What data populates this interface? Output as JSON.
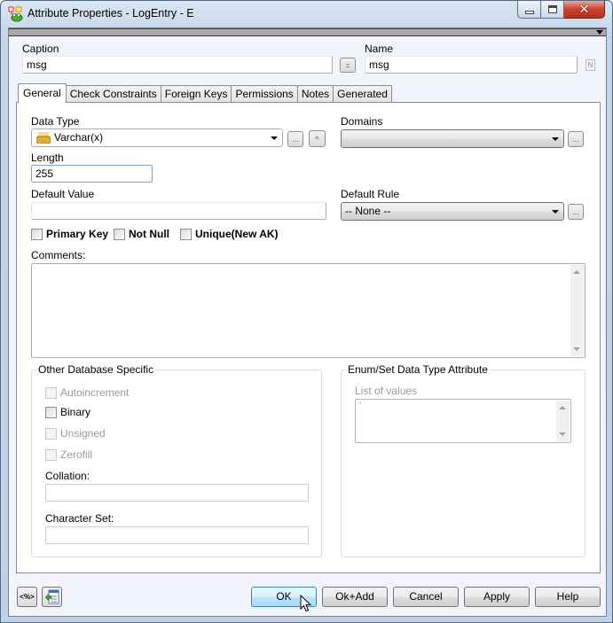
{
  "window": {
    "title": "Attribute Properties - LogEntry - E",
    "app_icon": "erwin-frog-icon"
  },
  "header": {
    "caption_label": "Caption",
    "caption_value": "msg",
    "equals_button": "=",
    "name_label": "Name",
    "name_value": "msg",
    "name_badge": "N"
  },
  "tabs": [
    {
      "label": "General",
      "active": true
    },
    {
      "label": "Check Constraints",
      "active": false
    },
    {
      "label": "Foreign Keys",
      "active": false
    },
    {
      "label": "Permissions",
      "active": false
    },
    {
      "label": "Notes",
      "active": false
    },
    {
      "label": "Generated",
      "active": false
    }
  ],
  "general": {
    "data_type_label": "Data Type",
    "data_type_value": "Varchar(x)",
    "browse_button": "...",
    "up_button": "^",
    "domains_label": "Domains",
    "domains_value": "",
    "domains_browse": "...",
    "length_label": "Length",
    "length_value": "255",
    "default_value_label": "Default Value",
    "default_value": "",
    "default_rule_label": "Default Rule",
    "default_rule_value": "-- None --",
    "default_rule_browse": "...",
    "checkboxes": [
      {
        "label": "Primary Key",
        "checked": false
      },
      {
        "label": "Not Null",
        "checked": false
      },
      {
        "label": "Unique(New AK)",
        "checked": false
      }
    ],
    "comments_label": "Comments:",
    "comments_value": ""
  },
  "other_db": {
    "title": "Other Database Specific",
    "options": [
      {
        "label": "Autoincrement",
        "checked": false,
        "enabled": false
      },
      {
        "label": "Binary",
        "checked": false,
        "enabled": true
      },
      {
        "label": "Unsigned",
        "checked": false,
        "enabled": false
      },
      {
        "label": "Zerofill",
        "checked": false,
        "enabled": false
      }
    ],
    "collation_label": "Collation:",
    "collation_value": "",
    "charset_label": "Character Set:",
    "charset_value": ""
  },
  "enum_set": {
    "title": "Enum/Set Data Type Attribute",
    "list_label": "List of values",
    "list_value": "\""
  },
  "footer": {
    "script_button_icon": "<%>",
    "buttons": {
      "ok": "OK",
      "ok_add": "Ok+Add",
      "cancel": "Cancel",
      "apply": "Apply",
      "help": "Help"
    }
  }
}
